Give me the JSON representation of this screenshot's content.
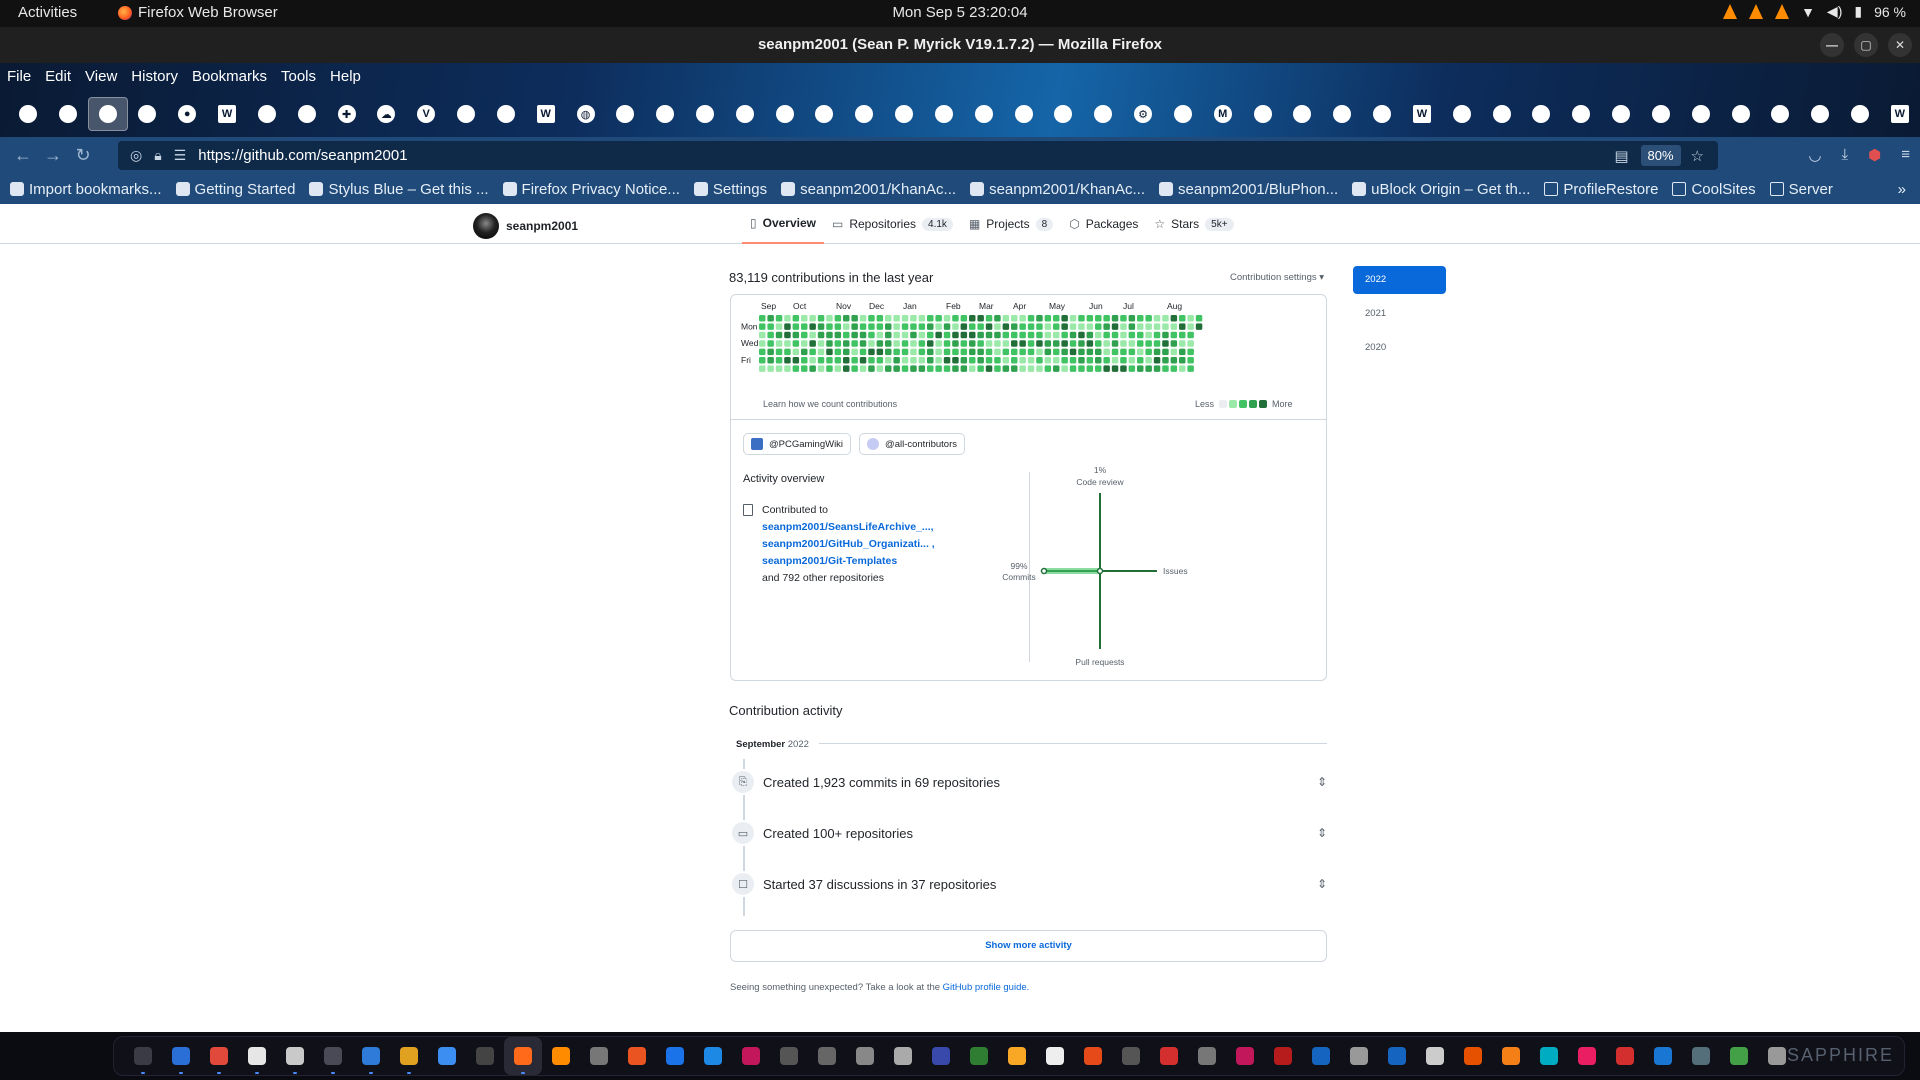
{
  "system": {
    "activities": "Activities",
    "app_name": "Firefox Web Browser",
    "clock": "Mon Sep 5  23:20:04",
    "battery": "96 %"
  },
  "window": {
    "title": "seanpm2001 (Sean P. Myrick V19.1.7.2) — Mozilla Firefox"
  },
  "menu": [
    "File",
    "Edit",
    "View",
    "History",
    "Bookmarks",
    "Tools",
    "Help"
  ],
  "tabs": [
    "github-icon",
    "github-icon",
    "github-icon",
    "github-icon",
    "firefox-icon",
    "wikipedia-icon",
    "github-icon",
    "github-icon",
    "puzzle-icon",
    "cloud-icon",
    "vue-icon",
    "github-icon",
    "github-icon",
    "wikipedia-icon",
    "globe-icon",
    "github-icon",
    "github-icon",
    "github-icon",
    "github-icon",
    "github-icon",
    "github-icon",
    "github-icon",
    "github-icon",
    "github-icon",
    "github-icon",
    "github-icon",
    "github-icon",
    "github-icon",
    "gear-icon",
    "github-icon",
    "mail-icon",
    "github-icon",
    "github-icon",
    "github-icon",
    "github-icon",
    "wikipedia-icon",
    "github-icon",
    "github-icon",
    "github-icon",
    "github-icon",
    "github-icon",
    "github-icon",
    "github-icon",
    "github-icon",
    "github-icon",
    "github-icon",
    "github-icon",
    "wikipedia-icon"
  ],
  "active_tab_index": 2,
  "address": {
    "url": "https://github.com/seanpm2001",
    "zoom": "80%"
  },
  "bookmarks": [
    {
      "label": "Import bookmarks...",
      "icon": "import-icon"
    },
    {
      "label": "Getting Started",
      "icon": "firefox-icon"
    },
    {
      "label": "Stylus Blue – Get this ...",
      "icon": "stylus-icon"
    },
    {
      "label": "Firefox Privacy Notice...",
      "icon": "mozilla-icon"
    },
    {
      "label": "Settings",
      "icon": "gear-icon"
    },
    {
      "label": "seanpm2001/KhanAc...",
      "icon": "github-icon"
    },
    {
      "label": "seanpm2001/KhanAc...",
      "icon": "github-icon"
    },
    {
      "label": "seanpm2001/BluPhon...",
      "icon": "github-icon"
    },
    {
      "label": "uBlock Origin – Get th...",
      "icon": "ublock-icon"
    },
    {
      "label": "ProfileRestore",
      "icon": "folder-icon"
    },
    {
      "label": "CoolSites",
      "icon": "folder-icon"
    },
    {
      "label": "Server",
      "icon": "folder-icon"
    }
  ],
  "github": {
    "username": "seanpm2001",
    "tabs": [
      {
        "label": "Overview",
        "icon": "book-icon",
        "count": ""
      },
      {
        "label": "Repositories",
        "icon": "repo-icon",
        "count": "4.1k"
      },
      {
        "label": "Projects",
        "icon": "table-icon",
        "count": "8"
      },
      {
        "label": "Packages",
        "icon": "package-icon",
        "count": ""
      },
      {
        "label": "Stars",
        "icon": "star-icon",
        "count": "5k+"
      }
    ],
    "contributions_title": "83,119 contributions in the last year",
    "contribution_settings": "Contribution settings ▾",
    "months": [
      "Sep",
      "Oct",
      "Nov",
      "Dec",
      "Jan",
      "Feb",
      "Mar",
      "Apr",
      "May",
      "Jun",
      "Jul",
      "Aug"
    ],
    "weekdays": [
      "Mon",
      "Wed",
      "Fri"
    ],
    "learn_link": "Learn how we count contributions",
    "legend_less": "Less",
    "legend_more": "More",
    "graph_colors": [
      "#ebedf0",
      "#9be9a8",
      "#40c463",
      "#30a14e",
      "#216e39"
    ],
    "orgs": [
      "@PCGamingWiki",
      "@all-contributors"
    ],
    "activity_overview": "Activity overview",
    "contributed_to": "Contributed to",
    "repos": [
      "seanpm2001/SeansLifeArchive_...,",
      "seanpm2001/GitHub_Organizati... ,",
      "seanpm2001/Git-Templates"
    ],
    "other_repos": "and 792 other repositories",
    "axes": {
      "code_review_pct": "1%",
      "code_review": "Code review",
      "commits_pct": "99%",
      "commits": "Commits",
      "issues": "Issues",
      "pull_requests": "Pull requests"
    },
    "contribution_activity": "Contribution activity",
    "month_label": "September",
    "month_year": "2022",
    "activities": [
      {
        "text": "Created 1,923 commits in 69 repositories",
        "icon": "commit-icon"
      },
      {
        "text": "Created 100+ repositories",
        "icon": "repo-icon"
      },
      {
        "text": "Started 37 discussions in 37 repositories",
        "icon": "discussion-icon"
      }
    ],
    "show_more": "Show more activity",
    "footnote_text": "Seeing something unexpected? Take a look at the",
    "footnote_link": "GitHub profile guide.",
    "years": [
      "2022",
      "2021",
      "2020"
    ],
    "selected_year": "2022"
  },
  "dock": {
    "brand": "SAPPHIRE",
    "icons": [
      "terminal-icon",
      "files-icon",
      "chrome-icon",
      "libreoffice-icon",
      "document-icon",
      "screenshot-icon",
      "writer-icon",
      "impress-icon",
      "text-editor-icon",
      "terminal2-icon",
      "firefox-icon",
      "vlc-icon",
      "settings-icon",
      "software-icon",
      "calendar-icon",
      "help-icon",
      "monitor-icon",
      "obs-icon",
      "tool-icon",
      "up-icon",
      "cube-icon",
      "disc-icon",
      "spreadsheet-icon",
      "archive-icon",
      "document2-icon",
      "backpack-icon",
      "dark-icon",
      "pdf-icon",
      "font-icon",
      "music-icon",
      "package-icon",
      "calc-icon",
      "accessibility-icon",
      "puzzle-icon",
      "webcam-icon",
      "person-icon",
      "chat-icon",
      "c-icon",
      "game-icon",
      "flag-icon",
      "bug-icon",
      "window-icon",
      "book-icon",
      "grid-icon"
    ]
  }
}
